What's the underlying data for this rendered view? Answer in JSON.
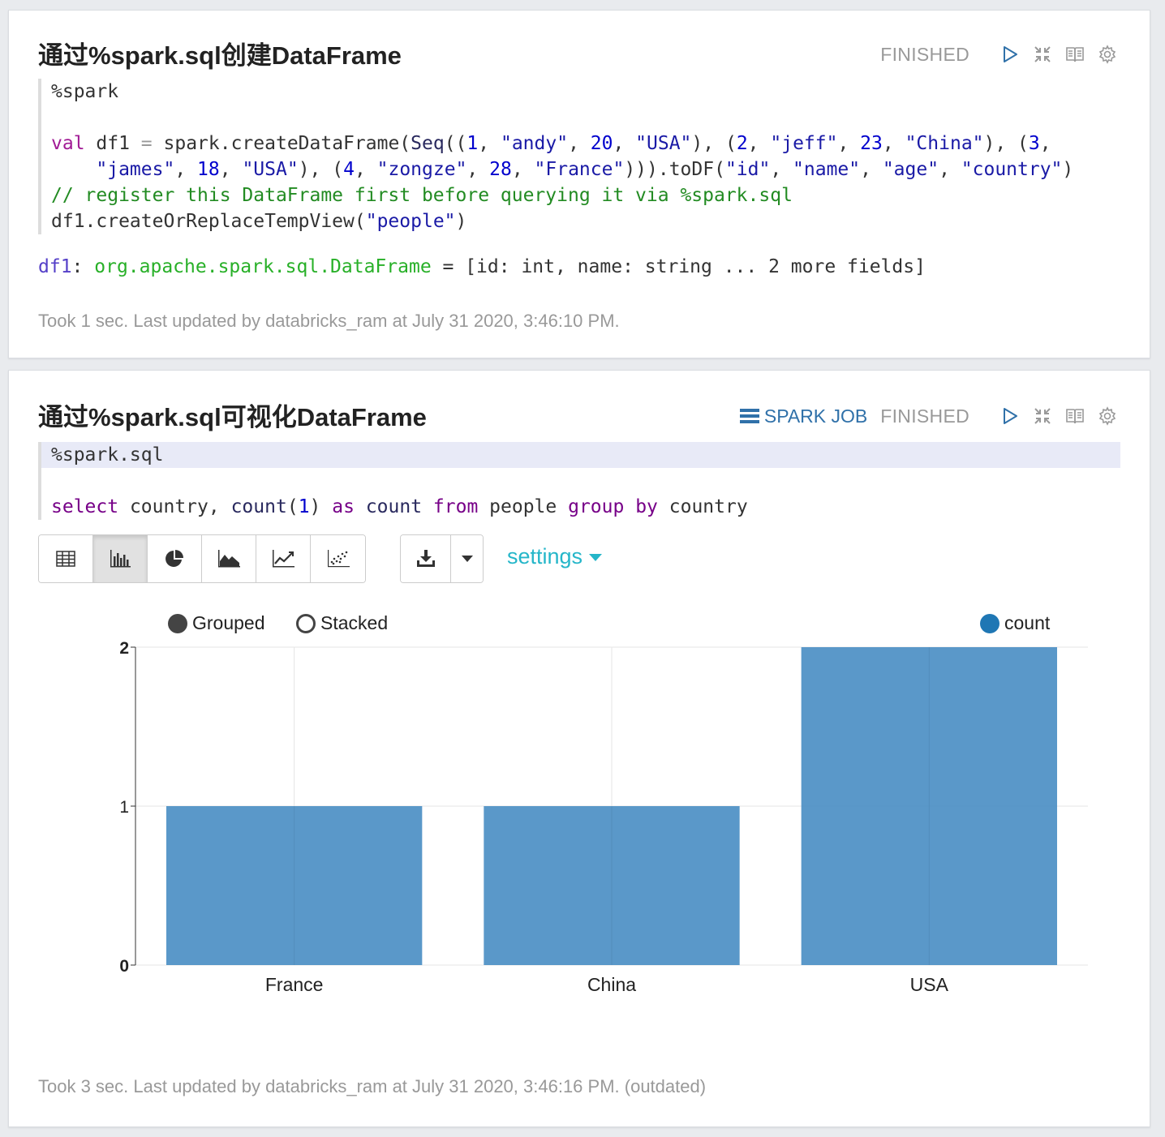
{
  "paragraph1": {
    "title": "通过%spark.sql创建DataFrame",
    "status": "FINISHED",
    "code_lines": [
      [
        {
          "t": "%spark",
          "c": "magic"
        }
      ],
      [],
      [
        {
          "t": "val",
          "c": "kw"
        },
        {
          "t": " df1 ",
          "c": "fn"
        },
        {
          "t": "=",
          "c": "op"
        },
        {
          "t": " spark.createDataFrame(",
          "c": "fn"
        },
        {
          "t": "Seq",
          "c": "tn"
        },
        {
          "t": "((",
          "c": "fn"
        },
        {
          "t": "1",
          "c": "num"
        },
        {
          "t": ", ",
          "c": "fn"
        },
        {
          "t": "\"andy\"",
          "c": "str"
        },
        {
          "t": ", ",
          "c": "fn"
        },
        {
          "t": "20",
          "c": "num"
        },
        {
          "t": ", ",
          "c": "fn"
        },
        {
          "t": "\"USA\"",
          "c": "str"
        },
        {
          "t": "), (",
          "c": "fn"
        },
        {
          "t": "2",
          "c": "num"
        },
        {
          "t": ", ",
          "c": "fn"
        },
        {
          "t": "\"jeff\"",
          "c": "str"
        },
        {
          "t": ", ",
          "c": "fn"
        },
        {
          "t": "23",
          "c": "num"
        },
        {
          "t": ", ",
          "c": "fn"
        },
        {
          "t": "\"China\"",
          "c": "str"
        },
        {
          "t": "), (",
          "c": "fn"
        },
        {
          "t": "3",
          "c": "num"
        },
        {
          "t": ",",
          "c": "fn"
        }
      ],
      [
        {
          "t": "    ",
          "c": "fn"
        },
        {
          "t": "\"james\"",
          "c": "str"
        },
        {
          "t": ", ",
          "c": "fn"
        },
        {
          "t": "18",
          "c": "num"
        },
        {
          "t": ", ",
          "c": "fn"
        },
        {
          "t": "\"USA\"",
          "c": "str"
        },
        {
          "t": "), (",
          "c": "fn"
        },
        {
          "t": "4",
          "c": "num"
        },
        {
          "t": ", ",
          "c": "fn"
        },
        {
          "t": "\"zongze\"",
          "c": "str"
        },
        {
          "t": ", ",
          "c": "fn"
        },
        {
          "t": "28",
          "c": "num"
        },
        {
          "t": ", ",
          "c": "fn"
        },
        {
          "t": "\"France\"",
          "c": "str"
        },
        {
          "t": "))).toDF(",
          "c": "fn"
        },
        {
          "t": "\"id\"",
          "c": "str"
        },
        {
          "t": ", ",
          "c": "fn"
        },
        {
          "t": "\"name\"",
          "c": "str"
        },
        {
          "t": ", ",
          "c": "fn"
        },
        {
          "t": "\"age\"",
          "c": "str"
        },
        {
          "t": ", ",
          "c": "fn"
        },
        {
          "t": "\"country\"",
          "c": "str"
        },
        {
          "t": ")",
          "c": "fn"
        }
      ],
      [
        {
          "t": "// register this DataFrame first before querying it via %spark.sql",
          "c": "cmt"
        }
      ],
      [
        {
          "t": "df1.createOrReplaceTempView(",
          "c": "fn"
        },
        {
          "t": "\"people\"",
          "c": "str"
        },
        {
          "t": ")",
          "c": "fn"
        }
      ]
    ],
    "output": {
      "var": "df1",
      "sep": ": ",
      "type": "org.apache.spark.sql.DataFrame",
      "rest": " = [id: int, name: string ... 2 more fields]"
    },
    "footer": "Took 1 sec. Last updated by databricks_ram at July 31 2020, 3:46:10 PM."
  },
  "paragraph2": {
    "title": "通过%spark.sql可视化DataFrame",
    "spark_job_label": "SPARK JOB",
    "status": "FINISHED",
    "code_lines": [
      [
        {
          "t": "%spark.sql",
          "c": "magic"
        }
      ],
      [],
      [
        {
          "t": "select",
          "c": "purple"
        },
        {
          "t": " country, ",
          "c": "fn"
        },
        {
          "t": "count",
          "c": "tn"
        },
        {
          "t": "(",
          "c": "fn"
        },
        {
          "t": "1",
          "c": "num"
        },
        {
          "t": ") ",
          "c": "fn"
        },
        {
          "t": "as",
          "c": "purple"
        },
        {
          "t": " ",
          "c": "fn"
        },
        {
          "t": "count",
          "c": "tn"
        },
        {
          "t": " ",
          "c": "fn"
        },
        {
          "t": "from",
          "c": "purple"
        },
        {
          "t": " people ",
          "c": "fn"
        },
        {
          "t": "group",
          "c": "purple"
        },
        {
          "t": " ",
          "c": "fn"
        },
        {
          "t": "by",
          "c": "purple"
        },
        {
          "t": " country",
          "c": "fn"
        }
      ]
    ],
    "settings_label": "settings",
    "chart_controls": {
      "grouped_label": "Grouped",
      "stacked_label": "Stacked",
      "selected": "Grouped"
    },
    "footer": "Took 3 sec. Last updated by databricks_ram at July 31 2020, 3:46:16 PM. (outdated)"
  },
  "colors": {
    "bar": "#4c8fc4",
    "legend_count": "#1f77b4",
    "accent": "#25b6c9",
    "spark_job": "#3071a9"
  },
  "chart_data": {
    "type": "bar",
    "categories": [
      "France",
      "China",
      "USA"
    ],
    "series": [
      {
        "name": "count",
        "values": [
          1,
          1,
          2
        ]
      }
    ],
    "yticks": [
      0,
      1,
      2
    ],
    "ylim": [
      0,
      2
    ],
    "grid": true,
    "legend": "top-right"
  }
}
